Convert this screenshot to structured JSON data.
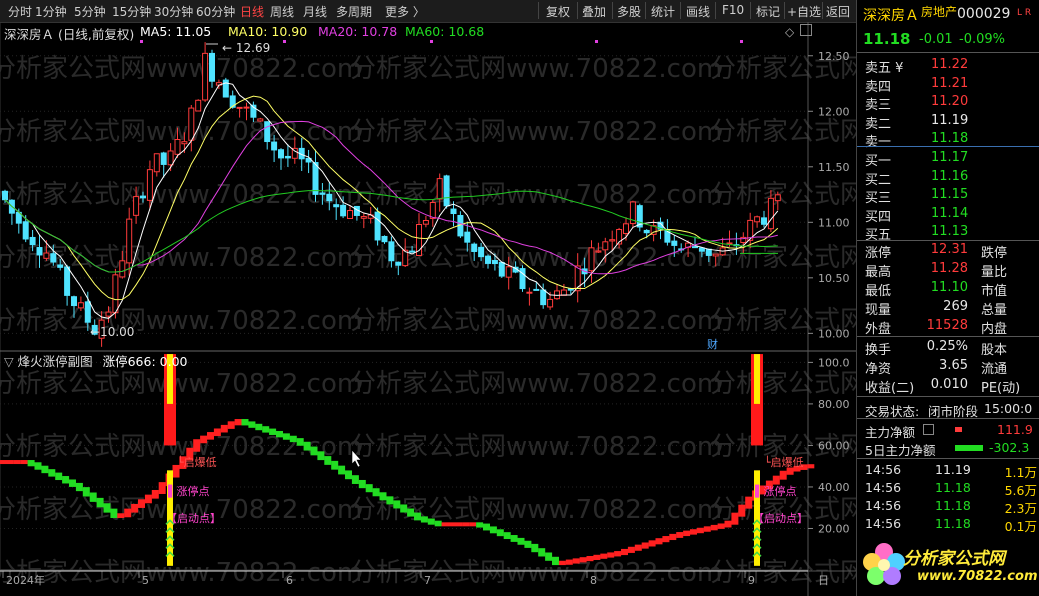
{
  "toolbar": {
    "periods": [
      "分时",
      "1分钟",
      "5分钟",
      "15分钟",
      "30分钟",
      "60分钟",
      "日线",
      "周线",
      "月线",
      "多周期",
      "更多 〉"
    ],
    "active_period": "日线",
    "right_buttons": [
      "复权",
      "叠加",
      "多股",
      "统计",
      "画线",
      "F10",
      "标记",
      "+自选",
      "返回"
    ]
  },
  "main_chart": {
    "title": "深深房Ａ (日线,前复权)",
    "ma5": "MA5: 11.05",
    "ma10": "MA10: 10.90",
    "ma20": "MA20: 10.78",
    "ma60": "MA60: 10.68",
    "high_label": "12.69",
    "low_label": "10.00",
    "fin_marker": "财",
    "y_ticks": [
      "12.50",
      "12.00",
      "11.50",
      "11.00",
      "10.50",
      "10.00"
    ]
  },
  "sub_chart": {
    "title": "烽火涨停副图",
    "value": "涨停666: 0.00",
    "y_ticks": [
      "100.0",
      "80.00",
      "60.00",
      "40.00",
      "20.00"
    ],
    "signal_labels": [
      "启爆低",
      "涨停点",
      "启动点"
    ]
  },
  "x_axis": {
    "labels": [
      "2024年",
      "5",
      "6",
      "7",
      "8",
      "9"
    ],
    "corner": "日"
  },
  "watermark": "分析家公式网www.70822.com",
  "quote": {
    "name": "深深房Ａ",
    "sector": "房地产",
    "code": "000029",
    "flags": "L R",
    "price": "11.18",
    "change": "-0.01",
    "pct": "-0.09%"
  },
  "asks": [
    {
      "label": "卖五 ¥",
      "price": "11.22"
    },
    {
      "label": "卖四",
      "price": "11.21"
    },
    {
      "label": "卖三",
      "price": "11.20"
    },
    {
      "label": "卖二",
      "price": "11.19"
    },
    {
      "label": "卖一",
      "price": "11.18"
    }
  ],
  "bids": [
    {
      "label": "买一",
      "price": "11.17"
    },
    {
      "label": "买二",
      "price": "11.16"
    },
    {
      "label": "买三",
      "price": "11.15"
    },
    {
      "label": "买四",
      "price": "11.14"
    },
    {
      "label": "买五",
      "price": "11.13"
    }
  ],
  "stats": [
    {
      "k": "涨停",
      "v": "12.31",
      "k2": "跌停"
    },
    {
      "k": "最高",
      "v": "11.28",
      "k2": "量比"
    },
    {
      "k": "最低",
      "v": "11.10",
      "k2": "市值"
    },
    {
      "k": "现量",
      "v": "269",
      "k2": "总量"
    },
    {
      "k": "外盘",
      "v": "11528",
      "k2": "内盘"
    }
  ],
  "stats2": [
    {
      "k": "换手",
      "v": "0.25%",
      "k2": "股本"
    },
    {
      "k": "净资",
      "v": "3.65",
      "k2": "流通"
    },
    {
      "k": "收益(二)",
      "v": "0.010",
      "k2": "PE(动)"
    }
  ],
  "trade_status": {
    "label": "交易状态:",
    "value": "闭市阶段",
    "time": "15:00:0"
  },
  "flows": [
    {
      "k": "主力净额",
      "v": "111.9"
    },
    {
      "k": "5日主力净额",
      "v": "-302.3"
    }
  ],
  "ticks": [
    {
      "t": "14:56",
      "p": "11.19",
      "v": "1.1万"
    },
    {
      "t": "14:56",
      "p": "11.18",
      "v": "5.6万"
    },
    {
      "t": "14:56",
      "p": "11.18",
      "v": "2.3万"
    },
    {
      "t": "14:56",
      "p": "11.18",
      "v": "0.1万"
    }
  ],
  "logo": {
    "text": "分析家公式网",
    "url": "www.70822.com"
  },
  "colors": {
    "up": "#ff3b3b",
    "down": "#22dd22",
    "ma5": "#ffffff",
    "ma10": "#ffff66",
    "ma20": "#e040e0",
    "ma60": "#22cc22",
    "candle_down": "#4fe3ff"
  }
}
